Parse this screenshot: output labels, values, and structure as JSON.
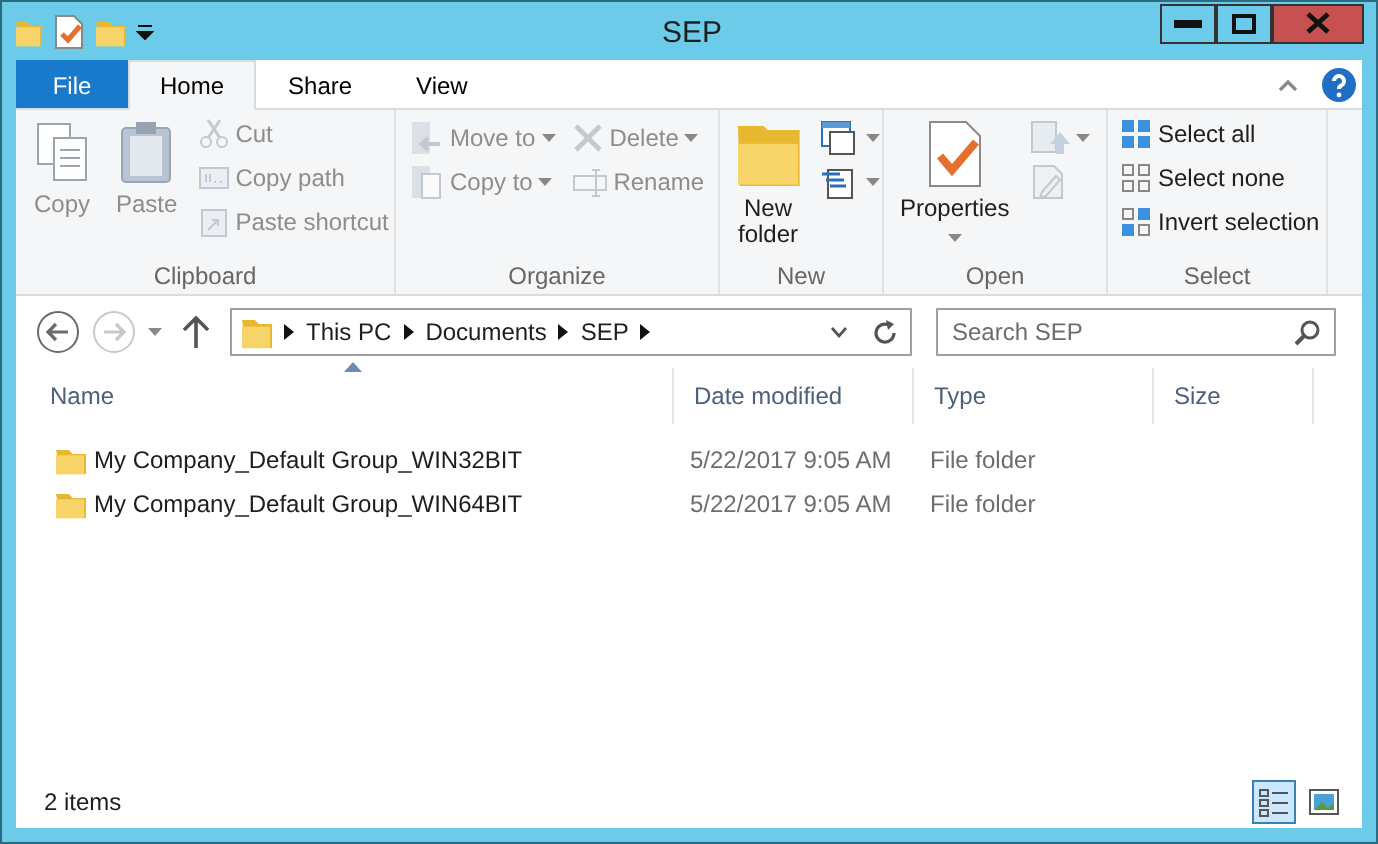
{
  "window": {
    "title": "SEP"
  },
  "quick_access": [
    {
      "kind": "properties"
    },
    {
      "kind": "folder"
    }
  ],
  "ribbon_tabs": [
    {
      "label": "File",
      "kind": "file",
      "selected": false
    },
    {
      "label": "Home",
      "kind": "tab",
      "selected": true
    },
    {
      "label": "Share",
      "kind": "tab",
      "selected": false
    },
    {
      "label": "View",
      "kind": "tab",
      "selected": false
    }
  ],
  "ribbon_groups": [
    {
      "label": "Clipboard",
      "commands": [
        {
          "label": "Copy",
          "kind": "large",
          "disabled": true
        },
        {
          "label": "Paste",
          "kind": "large",
          "disabled": true
        },
        {
          "kind": "stack",
          "items": [
            {
              "label": "Cut",
              "disabled": true
            },
            {
              "label": "Copy path",
              "disabled": true
            },
            {
              "label": "Paste shortcut",
              "disabled": true
            }
          ]
        }
      ]
    },
    {
      "label": "Organize",
      "commands": [
        {
          "kind": "stack",
          "items": [
            {
              "label": "Move to",
              "disabled": true,
              "dropdown": true
            },
            {
              "label": "Copy to",
              "disabled": true,
              "dropdown": true
            }
          ]
        },
        {
          "kind": "stack",
          "items": [
            {
              "label": "Delete",
              "disabled": true,
              "dropdown": true
            },
            {
              "label": "Rename",
              "disabled": true
            }
          ]
        }
      ]
    },
    {
      "label": "New",
      "commands": [
        {
          "label": "New folder",
          "kind": "large",
          "disabled": false
        },
        {
          "kind": "stack",
          "items": [
            {
              "disabled": false,
              "dropdown": true
            },
            {
              "disabled": false,
              "dropdown": true
            }
          ]
        }
      ]
    },
    {
      "label": "Open",
      "commands": [
        {
          "label": "Properties",
          "kind": "large",
          "disabled": false,
          "dropdown": true
        },
        {
          "kind": "stack",
          "items": [
            {
              "disabled": true,
              "dropdown": true
            },
            {
              "disabled": true
            }
          ]
        }
      ]
    },
    {
      "label": "Select",
      "commands": [
        {
          "kind": "stack",
          "items": [
            {
              "label": "Select all",
              "disabled": false
            },
            {
              "label": "Select none",
              "disabled": false
            },
            {
              "label": "Invert selection",
              "disabled": false
            }
          ]
        }
      ]
    }
  ],
  "navigation": {
    "back_disabled": false,
    "forward_disabled": true
  },
  "address": {
    "breadcrumbs": [
      "This PC",
      "Documents",
      "SEP"
    ]
  },
  "search": {
    "placeholder": "Search SEP"
  },
  "columns": [
    {
      "label": "Name",
      "sorted": true
    },
    {
      "label": "Date modified",
      "sorted": false
    },
    {
      "label": "Type",
      "sorted": false
    },
    {
      "label": "Size",
      "sorted": false
    }
  ],
  "rows": [
    {
      "name": "My Company_Default Group_WIN32BIT",
      "date_modified": "5/22/2017 9:05 AM",
      "type": "File folder"
    },
    {
      "name": "My Company_Default Group_WIN64BIT",
      "date_modified": "5/22/2017 9:05 AM",
      "type": "File folder"
    }
  ],
  "status_bar": {
    "text": "2 items",
    "views": [
      {
        "kind": "details",
        "selected": true
      },
      {
        "kind": "large_icons",
        "selected": false
      }
    ]
  }
}
